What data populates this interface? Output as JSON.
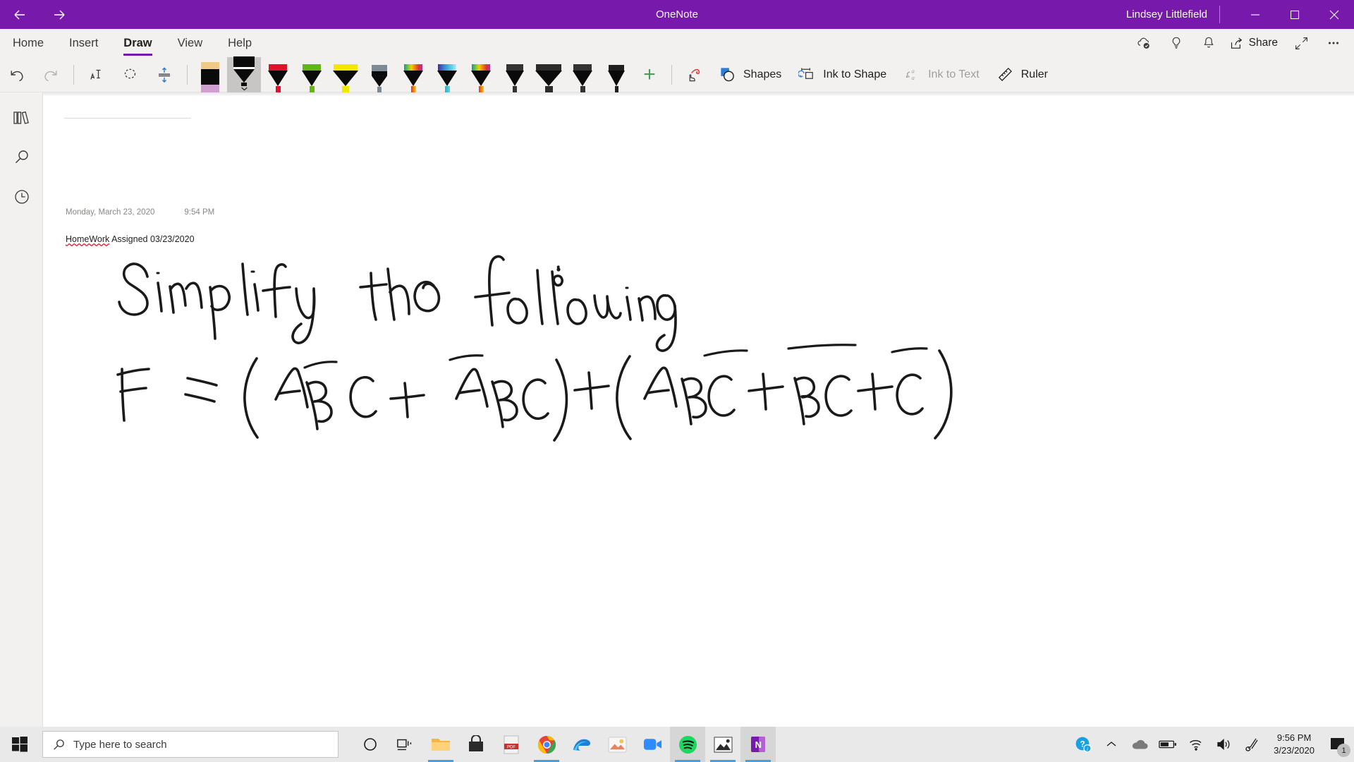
{
  "titlebar": {
    "back_label": "Back",
    "forward_label": "Forward",
    "app_title": "OneNote",
    "account_name": "Lindsey Littlefield",
    "minimize_label": "Minimize",
    "maximize_label": "Restore",
    "close_label": "Close",
    "bg_color": "#7719aa"
  },
  "ribbon": {
    "tabs": [
      {
        "label": "Home",
        "active": false
      },
      {
        "label": "Insert",
        "active": false
      },
      {
        "label": "Draw",
        "active": true
      },
      {
        "label": "View",
        "active": false
      },
      {
        "label": "Help",
        "active": false
      }
    ],
    "right_items": [
      {
        "name": "sync-status-icon",
        "label": "Sync status"
      },
      {
        "name": "tell-me-icon",
        "label": "Tell me what you want to do"
      },
      {
        "name": "notifications-bell-icon",
        "label": "Notifications"
      }
    ],
    "share_label": "Share",
    "expand_label": "Full screen",
    "more_label": "More options",
    "accent_color": "#7719aa"
  },
  "toolbar": {
    "undo_label": "Undo",
    "redo_label": "Redo",
    "lasso_select_label": "Lasso Select",
    "ink_to_text_pen_label": "Ink to Text Pen",
    "insert_space_label": "Insert Space",
    "pens": [
      {
        "name": "highlighter-tan",
        "type": "highlighter",
        "cap": "#f0c987",
        "tip": "#cf9fd0",
        "selected": false
      },
      {
        "name": "eraser",
        "type": "eraser",
        "cap": "#000000",
        "tip": "#ffffff",
        "selected": true
      },
      {
        "name": "pen-red",
        "type": "pen",
        "cap": "#e3102b",
        "tip": "#e3102b",
        "selected": false
      },
      {
        "name": "pen-green",
        "type": "pen",
        "cap": "#5fb817",
        "tip": "#5fb817",
        "selected": false
      },
      {
        "name": "highlighter-yellow",
        "type": "highlighter",
        "cap": "#f5e800",
        "tip": "#f5e800",
        "selected": false
      },
      {
        "name": "pencil-gray",
        "type": "pencil",
        "cap": "#7b8a94",
        "tip": "#7b8a94",
        "selected": false
      },
      {
        "name": "pen-rainbow-warm",
        "type": "pen",
        "cap": "rainbow-warm",
        "tip": "#e06020",
        "selected": false
      },
      {
        "name": "pen-rainbow-cool",
        "type": "pen",
        "cap": "rainbow-cool",
        "tip": "#2bb3c9",
        "selected": false
      },
      {
        "name": "pen-rainbow-warm-2",
        "type": "pen",
        "cap": "rainbow-warm",
        "tip": "#e06020",
        "selected": false
      },
      {
        "name": "pen-black-thin",
        "type": "pen",
        "cap": "#333333",
        "tip": "#333333",
        "selected": false
      },
      {
        "name": "highlighter-black-wide",
        "type": "highlighter",
        "cap": "#2b2b2b",
        "tip": "#2b2b2b",
        "selected": false
      },
      {
        "name": "pen-black-medium",
        "type": "pen",
        "cap": "#333333",
        "tip": "#333333",
        "selected": false
      },
      {
        "name": "pen-black-fine",
        "type": "pen",
        "cap": "#1f1f1f",
        "tip": "#1f1f1f",
        "selected": false
      }
    ],
    "add_pen_label": "+",
    "add_pen_color": "#4e9a5a",
    "ink_replay_label": "Ink Replay",
    "shapes_label": "Shapes",
    "ink_to_shape_label": "Ink to Shape",
    "ink_to_text_label": "Ink to Text",
    "ink_to_text_disabled": true,
    "ruler_label": "Ruler"
  },
  "rail": {
    "items": [
      {
        "name": "notebooks-icon",
        "label": "Notebooks"
      },
      {
        "name": "search-icon",
        "label": "Search"
      },
      {
        "name": "recent-notes-icon",
        "label": "Recent Notes"
      }
    ]
  },
  "page": {
    "date": "Monday, March 23, 2020",
    "time": "9:54 PM",
    "assigned_misspelled_word": "HomeWork",
    "assigned_rest": " Assigned 03/23/2020",
    "ink_line_1": "Simplify the following :",
    "ink_line_2": "F = (A B̄ C + Ā BC) + (A B C̄ + B̄C̄ + C̄ )",
    "ink_color": "#1a1a1a"
  },
  "taskbar": {
    "start_label": "Start",
    "search_placeholder": "Type here to search",
    "apps": [
      {
        "name": "cortana-icon",
        "label": "Cortana",
        "running": false,
        "active": false
      },
      {
        "name": "task-view-icon",
        "label": "Task View",
        "running": false,
        "active": false
      },
      {
        "name": "file-explorer-icon",
        "label": "File Explorer",
        "running": true,
        "active": false
      },
      {
        "name": "microsoft-store-icon",
        "label": "Microsoft Store",
        "running": false,
        "active": false
      },
      {
        "name": "pdf-reader-icon",
        "label": "PDF Reader",
        "running": false,
        "active": false
      },
      {
        "name": "google-chrome-icon",
        "label": "Google Chrome",
        "running": true,
        "active": false
      },
      {
        "name": "edge-icon",
        "label": "Microsoft Edge",
        "running": false,
        "active": false
      },
      {
        "name": "photos-icon",
        "label": "Photos",
        "running": false,
        "active": false
      },
      {
        "name": "zoom-icon",
        "label": "Zoom",
        "running": false,
        "active": false
      },
      {
        "name": "spotify-icon",
        "label": "Spotify",
        "running": true,
        "active": true
      },
      {
        "name": "video-player-icon",
        "label": "Movies & TV",
        "running": true,
        "active": false
      },
      {
        "name": "onenote-icon",
        "label": "OneNote",
        "running": true,
        "active": true
      }
    ],
    "tray": [
      {
        "name": "help-support-icon",
        "label": "Get Help"
      },
      {
        "name": "show-hidden-icons-chevron",
        "label": "Show hidden icons"
      },
      {
        "name": "onedrive-cloud-icon",
        "label": "OneDrive"
      },
      {
        "name": "battery-icon",
        "label": "Battery"
      },
      {
        "name": "wifi-icon",
        "label": "Network"
      },
      {
        "name": "volume-icon",
        "label": "Volume"
      },
      {
        "name": "pen-workspace-icon",
        "label": "Windows Ink Workspace"
      }
    ],
    "clock_time": "9:56 PM",
    "clock_date": "3/23/2020",
    "notification_count": "1"
  }
}
